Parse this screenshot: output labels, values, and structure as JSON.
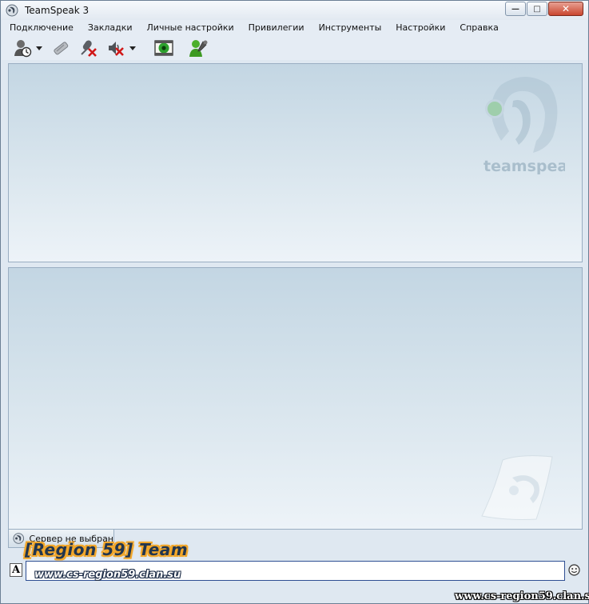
{
  "window": {
    "title": "TeamSpeak 3",
    "controls": {
      "minimize": "—",
      "maximize": "□",
      "close": "✕"
    }
  },
  "menu": {
    "items": [
      {
        "label": "Подключение"
      },
      {
        "label": "Закладки"
      },
      {
        "label": "Личные настройки"
      },
      {
        "label": "Привилегии"
      },
      {
        "label": "Инструменты"
      },
      {
        "label": "Настройки"
      },
      {
        "label": "Справка"
      }
    ]
  },
  "toolbar": {
    "buttons": [
      {
        "icon": "connect-icon",
        "has_dropdown": true
      },
      {
        "icon": "disconnect-icon",
        "has_dropdown": false
      },
      {
        "icon": "mute-microphone-icon",
        "has_dropdown": false
      },
      {
        "icon": "mute-speakers-icon",
        "has_dropdown": true
      },
      {
        "icon": "away-status-icon",
        "has_dropdown": false
      },
      {
        "icon": "identities-icon",
        "has_dropdown": false
      }
    ]
  },
  "server_panel": {
    "watermark": "teamspeak3"
  },
  "chat": {
    "tab_label": "Сервер не выбран",
    "input_value": "",
    "format_button": "A"
  },
  "overlay": {
    "team_name": "[Region 59] Team",
    "url": "www.cs-region59.clan.su",
    "corner_url": "www.cs-region59.clan.su"
  },
  "colors": {
    "pane_top": "#c3d6e3",
    "pane_bottom": "#edf3f8",
    "input_border": "#2f4f93"
  }
}
